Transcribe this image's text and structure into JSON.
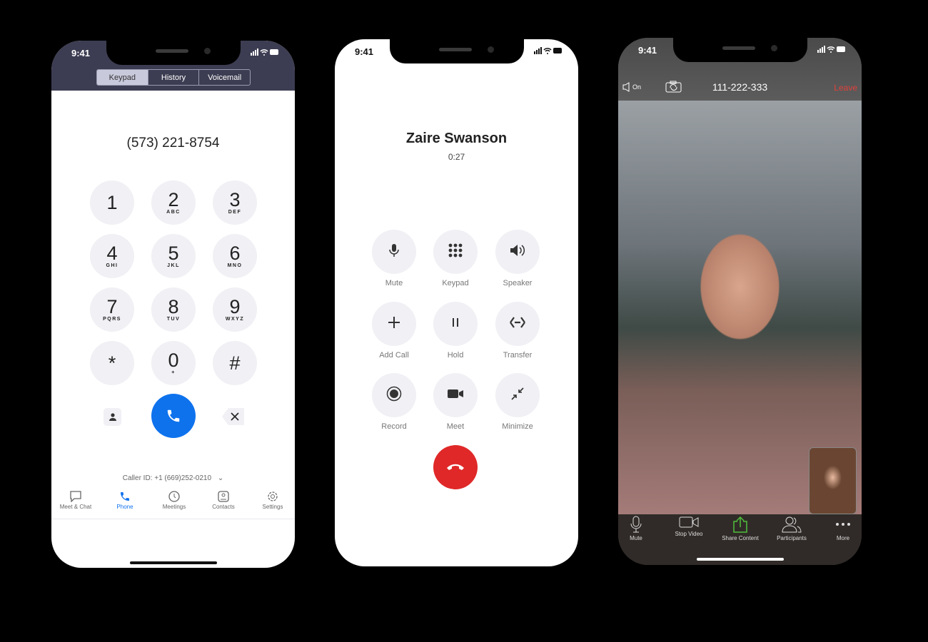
{
  "status": {
    "time": "9:41"
  },
  "keypad_screen": {
    "tabs": [
      {
        "label": "Keypad",
        "active": true
      },
      {
        "label": "History"
      },
      {
        "label": "Voicemail"
      }
    ],
    "number": "(573) 221-8754",
    "keys": [
      {
        "d": "1",
        "l": ""
      },
      {
        "d": "2",
        "l": "ABC"
      },
      {
        "d": "3",
        "l": "DEF"
      },
      {
        "d": "4",
        "l": "GHI"
      },
      {
        "d": "5",
        "l": "JKL"
      },
      {
        "d": "6",
        "l": "MNO"
      },
      {
        "d": "7",
        "l": "PQRS"
      },
      {
        "d": "8",
        "l": "TUV"
      },
      {
        "d": "9",
        "l": "WXYZ"
      },
      {
        "d": "*",
        "l": ""
      },
      {
        "d": "0",
        "l": "+"
      },
      {
        "d": "#",
        "l": ""
      }
    ],
    "caller_id": "Caller ID: +1 (669)252-0210",
    "nav": [
      {
        "label": "Meet & Chat",
        "icon": "chat-icon"
      },
      {
        "label": "Phone",
        "icon": "phone-icon",
        "active": true
      },
      {
        "label": "Meetings",
        "icon": "clock-icon"
      },
      {
        "label": "Contacts",
        "icon": "contacts-icon"
      },
      {
        "label": "Settings",
        "icon": "gear-icon"
      }
    ],
    "accent": "#0e72ed"
  },
  "call_screen": {
    "name": "Zaire Swanson",
    "duration": "0:27",
    "controls": [
      {
        "label": "Mute",
        "icon": "mic-icon"
      },
      {
        "label": "Keypad",
        "icon": "keypad-icon"
      },
      {
        "label": "Speaker",
        "icon": "speaker-icon"
      },
      {
        "label": "Add Call",
        "icon": "plus-icon"
      },
      {
        "label": "Hold",
        "icon": "pause-icon"
      },
      {
        "label": "Transfer",
        "icon": "transfer-icon"
      },
      {
        "label": "Record",
        "icon": "record-icon"
      },
      {
        "label": "Meet",
        "icon": "video-icon"
      },
      {
        "label": "Minimize",
        "icon": "minimize-icon"
      }
    ],
    "end_color": "#e02828"
  },
  "video_screen": {
    "audio": "On",
    "meeting_id": "111-222-333",
    "leave": "Leave",
    "toolbar": [
      {
        "label": "Mute",
        "icon": "mic-icon"
      },
      {
        "label": "Stop Video",
        "icon": "video-icon"
      },
      {
        "label": "Share Content",
        "icon": "share-icon"
      },
      {
        "label": "Participants",
        "icon": "participants-icon"
      },
      {
        "label": "More",
        "icon": "more-icon"
      }
    ],
    "leave_color": "#e0403c",
    "share_color": "#4fbf3a"
  }
}
